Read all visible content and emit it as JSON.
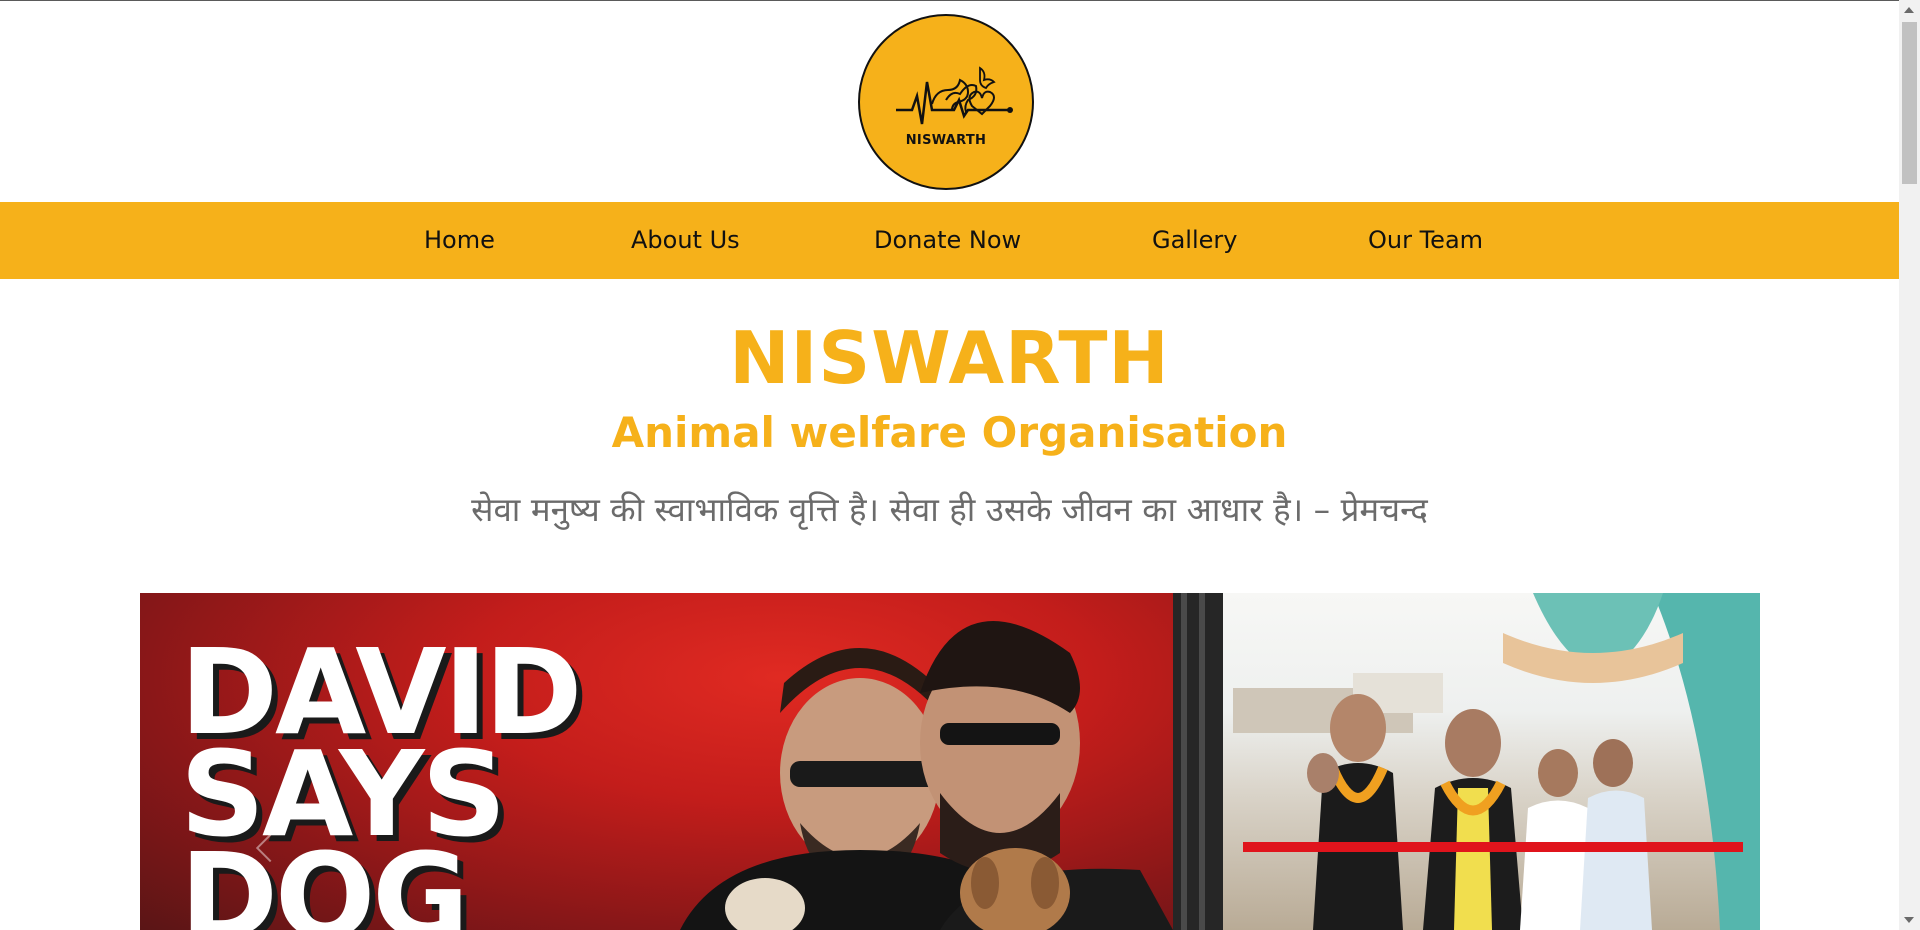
{
  "logo": {
    "text": "NISWARTH"
  },
  "nav": {
    "items": [
      {
        "label": "Home"
      },
      {
        "label": "About Us"
      },
      {
        "label": "Donate Now"
      },
      {
        "label": "Gallery"
      },
      {
        "label": "Our Team"
      }
    ]
  },
  "hero": {
    "title": "NISWARTH",
    "subtitle": "Animal welfare Organisation",
    "quote": "सेवा मनुष्य की स्वाभाविक वृत्ति है। सेवा ही उसके जीवन का आधार है। – प्रेमचन्द"
  },
  "carousel": {
    "slide_text": [
      "DAVID",
      "SAYS",
      "DOG"
    ]
  },
  "colors": {
    "accent": "#f6b11a",
    "nav_text": "#111111",
    "quote_text": "#6b6b6b"
  }
}
